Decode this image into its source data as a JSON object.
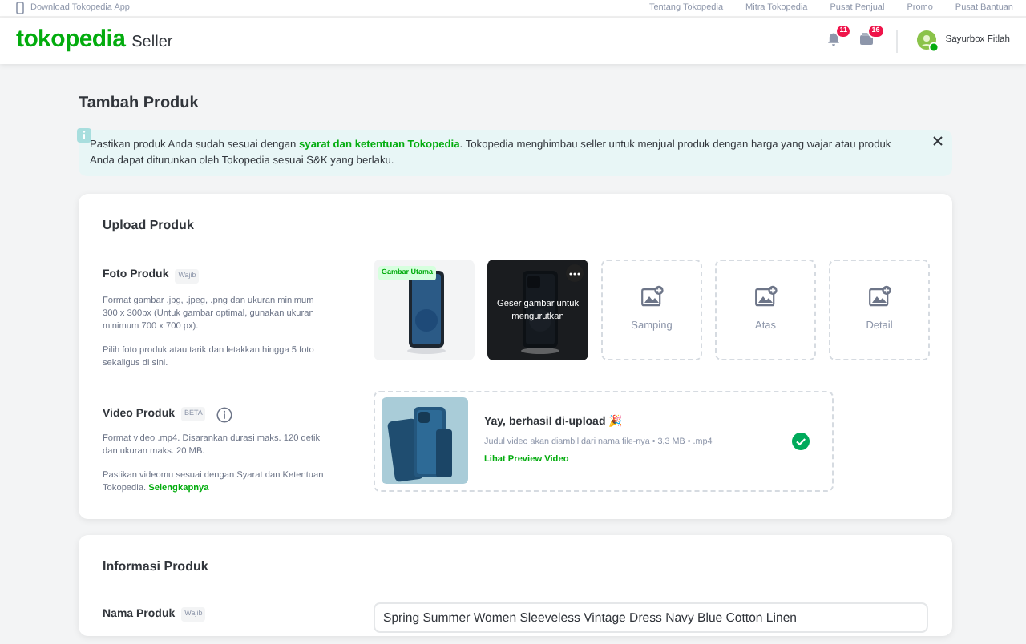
{
  "top_bar": {
    "download_link": "Download Tokopedia App",
    "links": [
      "Tentang Tokopedia",
      "Mitra Tokopedia",
      "Pusat Penjual",
      "Promo",
      "Pusat Bantuan"
    ]
  },
  "header": {
    "logo": "tokopedia",
    "logo_suffix": "Seller",
    "notification_count": "11",
    "message_count": "16",
    "user_name": "Sayurbox Fitlah",
    "user_online": true
  },
  "page_title": "Tambah Produk",
  "alert": {
    "text_before": "Pastikan produk Anda sudah sesuai dengan ",
    "link": "syarat dan ketentuan Tokopedia",
    "text_after": ". Tokopedia menghimbau seller untuk menjual produk dengan harga yang wajar atau produk Anda dapat diturunkan oleh Tokopedia sesuai S&K yang berlaku.",
    "dismissible": true
  },
  "upload_section": {
    "title": "Upload Produk",
    "photo": {
      "label": "Foto Produk",
      "tag": "Wajib",
      "description": [
        "Format gambar .jpg, .jpeg, .png dan ukuran minimum 300 x 300px (Untuk gambar optimal, gunakan ukuran minimum 700 x 700 px).",
        "Pilih foto produk atau tarik dan letakkan hingga 5 foto sekaligus di sini."
      ],
      "slots": [
        {
          "kind": "main",
          "badge": "Gambar Utama"
        },
        {
          "kind": "dragging",
          "overlay_text": "Geser gambar untuk mengurutkan"
        },
        {
          "kind": "empty",
          "label": "Samping"
        },
        {
          "kind": "empty",
          "label": "Atas"
        },
        {
          "kind": "empty",
          "label": "Detail"
        }
      ]
    },
    "video": {
      "label": "Video Produk",
      "tag": "BETA",
      "description": [
        "Format video .mp4. Disarankan durasi maks. 120 detik dan ukuran maks. 20 MB.",
        "Pastikan videomu sesuai dengan Syarat dan Ketentuan Tokopedia. "
      ],
      "description_link": "Selengkapnya",
      "upload": {
        "title": "Yay, berhasil di-upload 🎉",
        "meta": "Judul video akan diambil dari nama file-nya • 3,3 MB • .mp4",
        "link": "Lihat Preview Video",
        "uploaded": true
      }
    }
  },
  "info_section": {
    "title": "Informasi Produk",
    "name_field": {
      "label": "Nama Produk",
      "tag": "Wajib",
      "value": "Spring Summer Women Sleeveless Vintage Dress Navy Blue Cotton Linen"
    }
  }
}
